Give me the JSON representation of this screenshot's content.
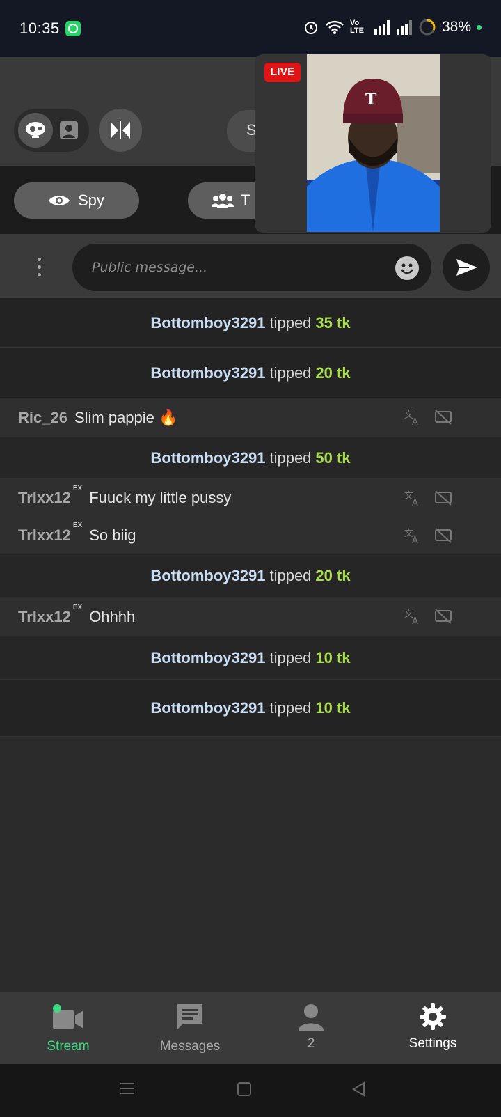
{
  "status_bar": {
    "time": "10:35",
    "battery": "38%",
    "network_label": "Vo LTE"
  },
  "toolbar": {
    "s_button_label": "S"
  },
  "filters": {
    "spy_label": "Spy",
    "t_label": "T"
  },
  "video": {
    "live_badge": "LIVE"
  },
  "composer": {
    "placeholder": "Public message..."
  },
  "chat": {
    "tip_verb": "tipped",
    "tips": [
      {
        "user": "Bottomboy3291",
        "amount": "35 tk"
      },
      {
        "user": "Bottomboy3291",
        "amount": "20 tk"
      },
      {
        "user": "Bottomboy3291",
        "amount": "50 tk"
      },
      {
        "user": "Bottomboy3291",
        "amount": "20 tk"
      },
      {
        "user": "Bottomboy3291",
        "amount": "10 tk"
      },
      {
        "user": "Bottomboy3291",
        "amount": "10 tk"
      }
    ],
    "messages": [
      {
        "user": "Ric_26",
        "badge": "",
        "text": "Slim pappie 🔥"
      },
      {
        "user": "Trlxx12",
        "badge": "EX",
        "text": "Fuuck my little pussy"
      },
      {
        "user": "Trlxx12",
        "badge": "EX",
        "text": "So biig"
      },
      {
        "user": "Trlxx12",
        "badge": "EX",
        "text": "Ohhhh"
      }
    ]
  },
  "nav": {
    "stream": "Stream",
    "messages": "Messages",
    "users_count": "2",
    "settings": "Settings"
  },
  "colors": {
    "accent_green": "#3ddc84",
    "tip_amount": "#a9dc4e",
    "live_red": "#e01414"
  }
}
